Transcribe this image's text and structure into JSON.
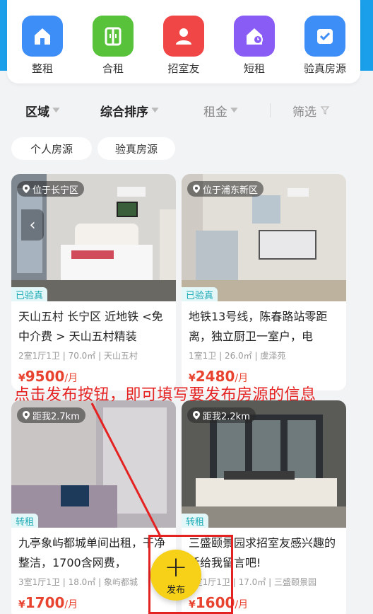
{
  "categories": [
    {
      "label": "整租",
      "icon": "house-icon",
      "color": "#3e8ef7"
    },
    {
      "label": "合租",
      "icon": "door-icon",
      "color": "#57c23a"
    },
    {
      "label": "招室友",
      "icon": "person-icon",
      "color": "#f04646"
    },
    {
      "label": "短租",
      "icon": "house-clock-icon",
      "color": "#8a5cf6"
    },
    {
      "label": "验真房源",
      "icon": "verify-icon",
      "color": "#3e8ef7"
    }
  ],
  "sort_bar": {
    "area": "区域",
    "overall": "综合排序",
    "rent": "租金",
    "filter": "筛选"
  },
  "chips": [
    "个人房源",
    "验真房源"
  ],
  "listings": [
    {
      "location": "位于长宁区",
      "tag": "已验真",
      "title": "天山五村 长宁区 近地铁 <免中介费 > 天山五村精装",
      "meta": "2室1厅1卫 | 70.0㎡ | 天山五村",
      "currency": "¥",
      "price": "9500",
      "unit": "/月"
    },
    {
      "location": "位于浦东新区",
      "tag": "已验真",
      "title": "地铁13号线，陈春路站零距离，独立厨卫一室户，电",
      "meta": "1室1卫 | 26.0㎡ | 虞泽苑",
      "currency": "¥",
      "price": "2480",
      "unit": "/月"
    },
    {
      "location": "距我2.7km",
      "tag": "转租",
      "title": "九亭象屿都城单间出租，干净整洁，1700含网费，",
      "meta": "3室1厅1卫 | 18.0㎡ | 象屿都城",
      "currency": "¥",
      "price": "1700",
      "unit": "/月"
    },
    {
      "location": "距我2.2km",
      "tag": "转租",
      "title": "三盛颐景园求招室友感兴趣的话给我留言吧!",
      "meta": "2室1厅1卫 | 17.0㎡ | 三盛颐景园",
      "currency": "¥",
      "price": "1600",
      "unit": "/月"
    }
  ],
  "annotation": "点击发布按钮，即可填写要发布房源的信息",
  "publish": {
    "label": "发布",
    "color": "#f6d117"
  },
  "colors": {
    "accent": "#1aa0ea",
    "price": "#e8432f",
    "annotation": "#e52222"
  }
}
